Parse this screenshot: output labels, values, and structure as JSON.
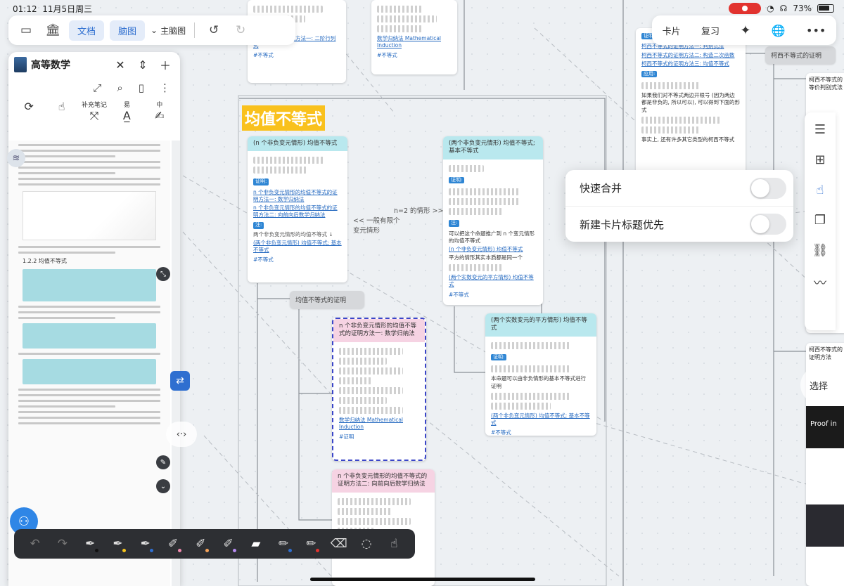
{
  "status_bar": {
    "time": "01:12",
    "date": "11月5日周三",
    "battery": "73%"
  },
  "toolbar": {
    "doc_tab": "文档",
    "mindmap_tab": "脑图",
    "theme_label": "主脑图"
  },
  "top_right": {
    "card": "卡片",
    "review": "复习"
  },
  "left_panel": {
    "title": "高等数学",
    "tools": [
      "",
      "",
      "补充笔记",
      "易",
      "中"
    ],
    "doc_section": "1.2.2   均值不等式"
  },
  "canvas": {
    "big_title": "均值不等式",
    "card1": {
      "title": "(n 个非负变元情形) 均值不等式",
      "proof_tag": "证明:",
      "link1": "n 个非负变元情形的均值不等式的证明方法一: 数学归纳法",
      "link2": "n 个非负变元情形的均值不等式的证明方法二: 向前向后数学归纳法",
      "note_tag": "注:",
      "note": "两个非负变元情形的均值不等式 ↓",
      "link3": "(两个非负变元情形) 均值不等式; 基本不等式",
      "hash": "#不等式"
    },
    "card2": {
      "title": "(两个非负变元情形) 均值不等式; 基本不等式",
      "proof_tag": "证明:",
      "note_tag": "注:",
      "bullet1": "可以把这个命题推广到 n 个变元情形的均值不等式",
      "link1": "(n 个非负变元情形) 均值不等式",
      "bullet2": "平方的情形其实本质都是同一个",
      "link2": "(两个实数变元的平方情形) 均值不等式",
      "hash": "#不等式"
    },
    "card3": {
      "title": "(两个实数变元的平方情形) 均值不等式",
      "proof_tag": "证明:",
      "bullet1": "本命题可以由非负情形的基本不等式进行证明",
      "link1": "(两个非负变元情形) 均值不等式; 基本不等式",
      "hash": "#不等式"
    },
    "card4": {
      "title": "n 个非负变元情形的均值不等式的证明方法一: 数学归纳法",
      "link1": "数学归纳法",
      "link2": "Mathematical Induction",
      "hash": "#证明"
    },
    "card5": {
      "title": "n 个非负变元情形的均值不等式的证明方法二: 向前向后数学归纳法"
    },
    "node_proof": "均值不等式的证明",
    "node_cauchy_proof": "柯西不等式的证明",
    "edge_left": "<< 一般有限个\n变元情形",
    "edge_right": "n=2 的情形 >>",
    "right_card_title": "柯西不等式的等价判别式法",
    "right_card2_title": "柯西不等式的证明方法",
    "top_card_links": [
      "柯西不等式的证明方法一: 二阶行列式",
      "数学归纳法",
      "Mathematical Induction"
    ],
    "hash_ineq": "#不等式",
    "top_right_links": [
      "柯西不等式的证明方法一: 判别式法",
      "柯西不等式的证明方法二: 构造二次函数",
      "柯西不等式的证明方法三: 均值不等式"
    ],
    "application_tag": "应用:",
    "proof_tag": "证明:",
    "cauchy_bullet1": "如果我们对不等式两边开根号 (因为两边都是非负的, 所以可以), 可以得到下面的形式",
    "cauchy_bullet2": "事实上, 还有许多其它类型的柯西不等式",
    "right_col_text": "Proof in",
    "select_label": "选择"
  },
  "popover": {
    "quick_merge": "快速合并",
    "new_card_title_first": "新建卡片标题优先"
  }
}
